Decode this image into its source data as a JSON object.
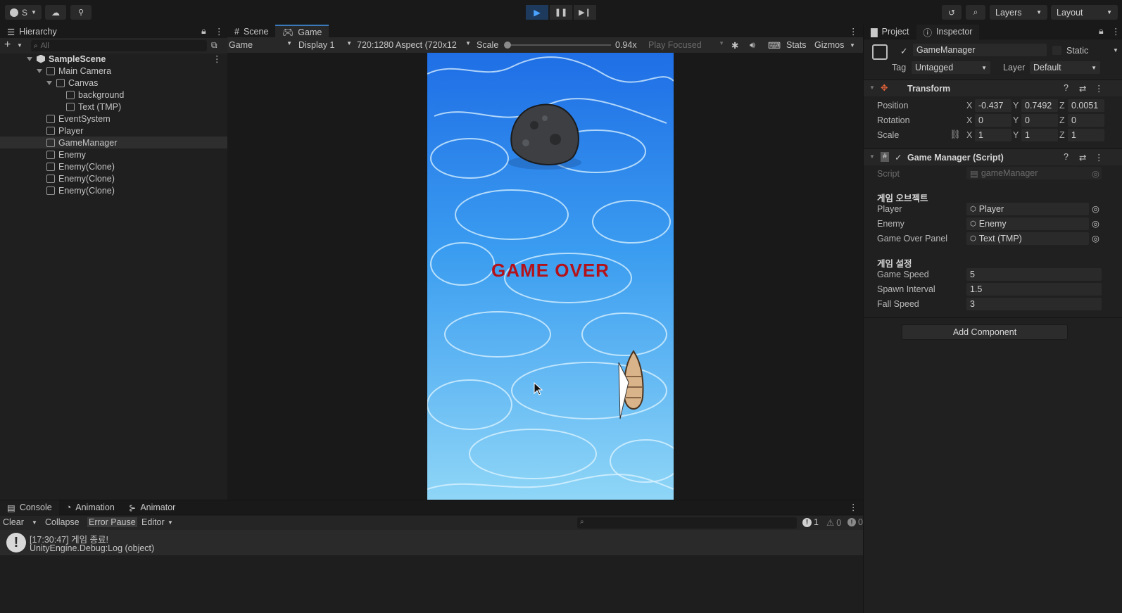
{
  "topbar": {
    "account_label": "S",
    "layers_label": "Layers",
    "layout_label": "Layout"
  },
  "hierarchy": {
    "tab_label": "Hierarchy",
    "search_placeholder": "All",
    "scene_name": "SampleScene",
    "items": [
      {
        "label": "Main Camera",
        "indent": 1,
        "expanded": true
      },
      {
        "label": "Canvas",
        "indent": 2,
        "expanded": true
      },
      {
        "label": "background",
        "indent": 3
      },
      {
        "label": "Text (TMP)",
        "indent": 3
      },
      {
        "label": "EventSystem",
        "indent": 1
      },
      {
        "label": "Player",
        "indent": 1
      },
      {
        "label": "GameManager",
        "indent": 1,
        "selected": true
      },
      {
        "label": "Enemy",
        "indent": 1
      },
      {
        "label": "Enemy(Clone)",
        "indent": 1
      },
      {
        "label": "Enemy(Clone)",
        "indent": 1
      },
      {
        "label": "Enemy(Clone)",
        "indent": 1
      }
    ]
  },
  "game_view": {
    "tabs": [
      "Scene",
      "Game"
    ],
    "active_tab": "Game",
    "toolbar": {
      "mode": "Game",
      "display": "Display 1",
      "aspect": "720:1280 Aspect (720x12",
      "scale_label": "Scale",
      "scale_value": "0.94x",
      "play_focused": "Play Focused",
      "stats": "Stats",
      "gizmos": "Gizmos"
    },
    "game_over_text": "GAME OVER"
  },
  "inspector": {
    "tabs": [
      "Project",
      "Inspector"
    ],
    "active_tab": "Inspector",
    "object_name": "GameManager",
    "static_label": "Static",
    "tag_label": "Tag",
    "tag_value": "Untagged",
    "layer_label": "Layer",
    "layer_value": "Default",
    "transform": {
      "title": "Transform",
      "position_label": "Position",
      "rotation_label": "Rotation",
      "scale_label": "Scale",
      "position": {
        "x": "-0.437",
        "y": "0.7492",
        "z": "0.0051"
      },
      "rotation": {
        "x": "0",
        "y": "0",
        "z": "0"
      },
      "scale": {
        "x": "1",
        "y": "1",
        "z": "1"
      }
    },
    "script_component": {
      "title": "Game Manager (Script)",
      "script_label": "Script",
      "script_value": "gameManager",
      "header1": "게임 오브젝트",
      "player_label": "Player",
      "player_value": "Player",
      "enemy_label": "Enemy",
      "enemy_value": "Enemy",
      "panel_label": "Game Over Panel",
      "panel_value": "Text (TMP)",
      "header2": "게임 설정",
      "speed_label": "Game Speed",
      "speed_value": "5",
      "spawn_label": "Spawn Interval",
      "spawn_value": "1.5",
      "fall_label": "Fall Speed",
      "fall_value": "3"
    },
    "add_component": "Add Component"
  },
  "console": {
    "tabs": [
      "Console",
      "Animation",
      "Animator"
    ],
    "active_tab": "Console",
    "clear": "Clear",
    "collapse": "Collapse",
    "error_pause": "Error Pause",
    "editor": "Editor",
    "count_log": "1",
    "count_warn": "0",
    "count_err": "0",
    "log_line1": "[17:30:47] 게임 종료!",
    "log_line2": "UnityEngine.Debug:Log (object)"
  }
}
